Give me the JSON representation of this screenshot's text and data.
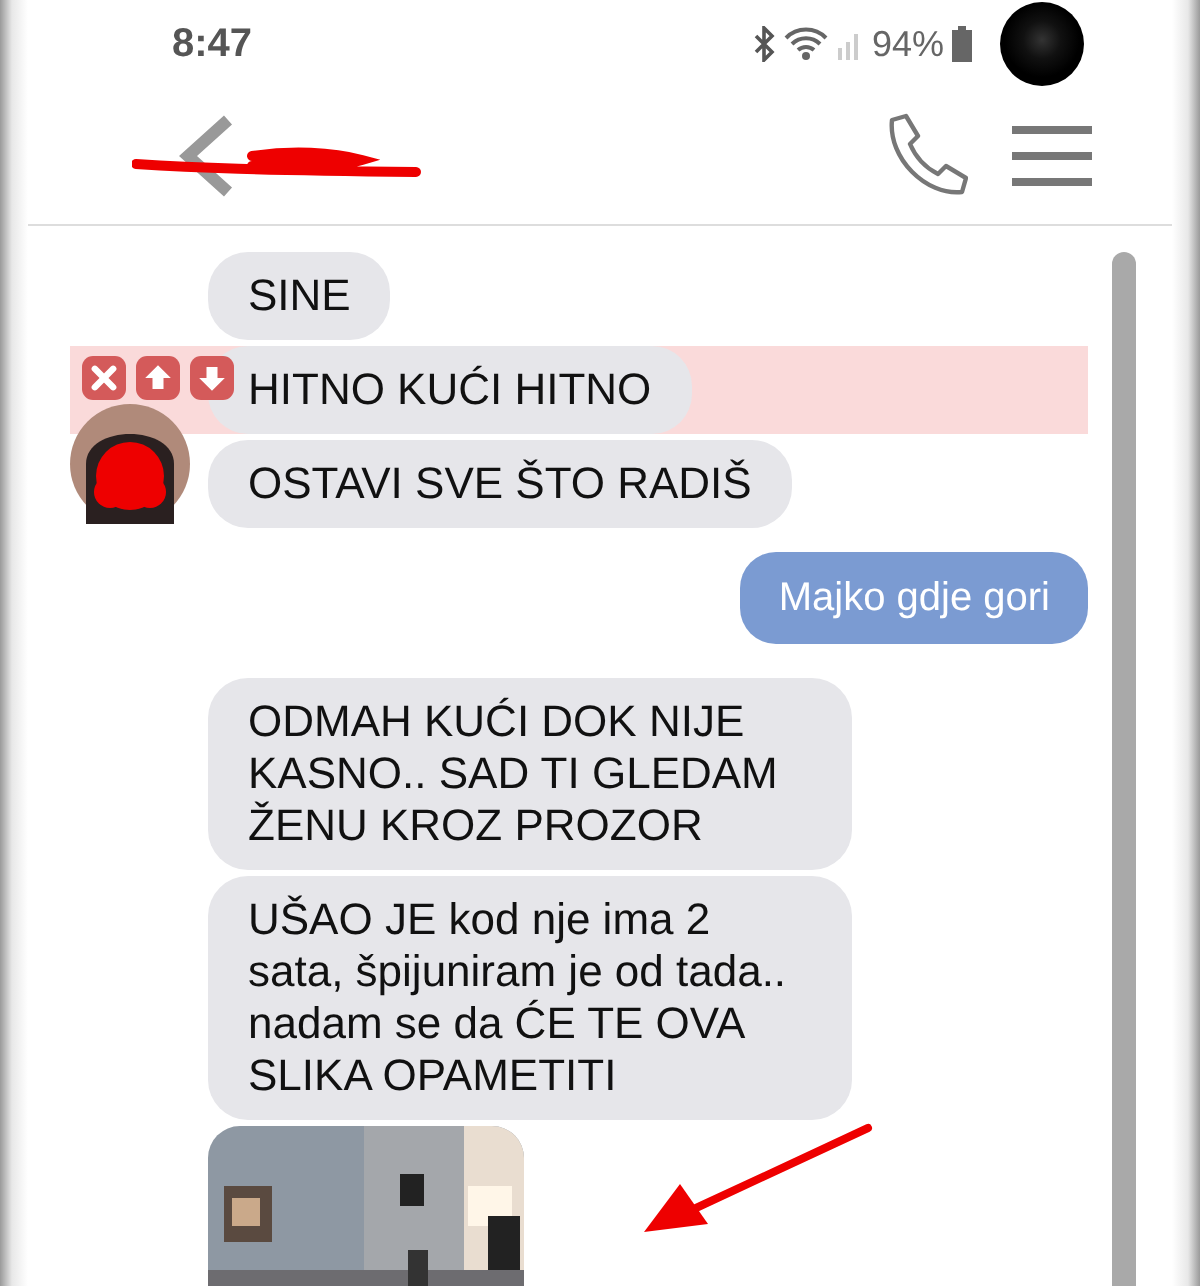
{
  "status_bar": {
    "time": "8:47",
    "battery": "94%"
  },
  "messages": [
    {
      "kind": "text",
      "sent": false,
      "text": "SINE",
      "highlighted": false,
      "avatar": false
    },
    {
      "kind": "text",
      "sent": false,
      "text": "HITNO KUĆI HITNO",
      "highlighted": true,
      "avatar": false
    },
    {
      "kind": "text",
      "sent": false,
      "text": "OSTAVI SVE ŠTO RADIŠ",
      "highlighted": false,
      "avatar": true
    },
    {
      "kind": "text",
      "sent": true,
      "text": "Majko gdje gori",
      "highlighted": false,
      "avatar": false
    },
    {
      "kind": "text",
      "sent": false,
      "text": "ODMAH KUĆI DOK NIJE KASNO.. SAD TI GLEDAM ŽENU KROZ PROZOR",
      "highlighted": false,
      "avatar": false
    },
    {
      "kind": "text",
      "sent": false,
      "text": "UŠAO JE kod nje ima 2 sata, špijuniram je od tada.. nadam se da ĆE TE OVA SLIKA OPAMETITI",
      "highlighted": false,
      "avatar": false
    },
    {
      "kind": "picture",
      "sent": false,
      "highlighted": false,
      "avatar": false
    }
  ]
}
